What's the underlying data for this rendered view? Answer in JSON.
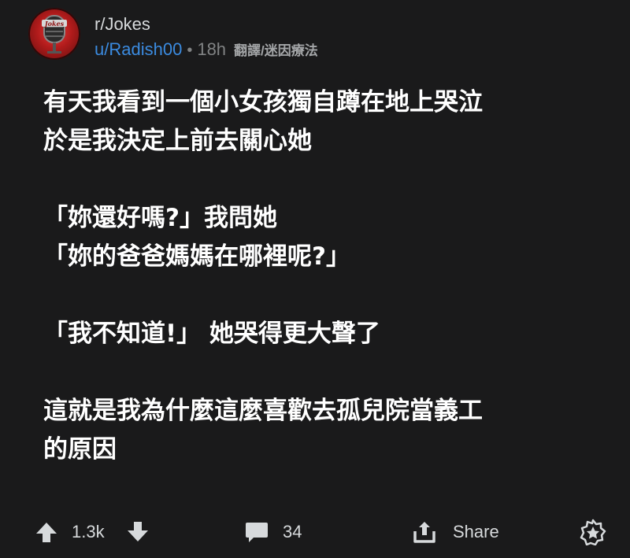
{
  "post": {
    "subreddit": "r/Jokes",
    "username": "u/Radish00",
    "separator": "•",
    "age": "18h",
    "flair": "翻譯/迷因療法",
    "avatar_icon": "jokes-microphone-icon",
    "body_paragraphs": [
      [
        "有天我看到一個小女孩獨自蹲在地上哭泣",
        "於是我決定上前去關心她"
      ],
      [
        "「妳還好嗎?」我問她",
        "「妳的爸爸媽媽在哪裡呢?」"
      ],
      [
        "「我不知道!」 她哭得更大聲了"
      ],
      [
        "這就是我為什麼這麼喜歡去孤兒院當義工",
        "的原因"
      ]
    ]
  },
  "actions": {
    "vote_count": "1.3k",
    "comment_count": "34",
    "share_label": "Share",
    "icons": [
      "upvote-icon",
      "downvote-icon",
      "comment-icon",
      "share-icon",
      "award-icon"
    ]
  },
  "colors": {
    "background": "#1a1a1b",
    "text": "#ffffff",
    "username": "#3b8be0",
    "muted": "#818384"
  }
}
